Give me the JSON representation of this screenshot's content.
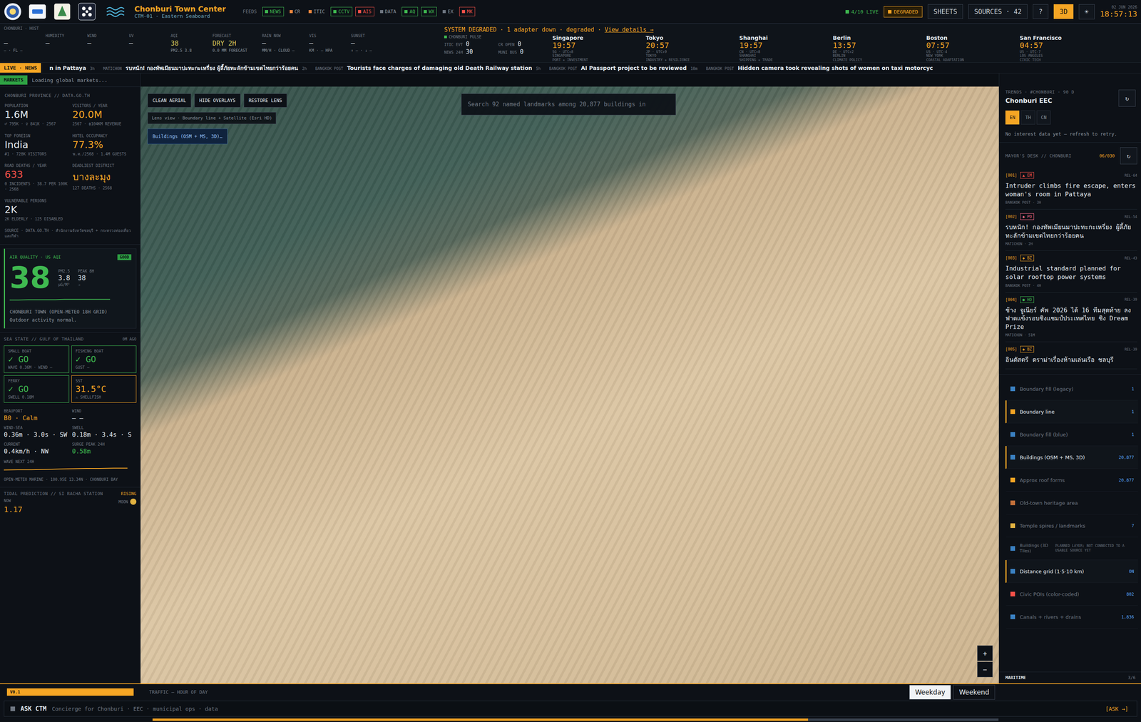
{
  "topbar": {
    "title": "Chonburi Town Center",
    "subtitle": "CTM-01 · Eastern Seaboard",
    "feeds_label": "FEEDS",
    "feeds": [
      {
        "label": "NEWS",
        "color": "#3fb950",
        "boxed": true
      },
      {
        "label": "CR",
        "color": "#f0883e",
        "boxed": false
      },
      {
        "label": "ITIC",
        "color": "#f0883e",
        "boxed": false
      },
      {
        "label": "CCTV",
        "color": "#3fb950",
        "boxed": true
      },
      {
        "label": "AIS",
        "color": "#f85149",
        "boxed": true
      },
      {
        "label": "DATA",
        "color": "#6e7681",
        "boxed": false
      },
      {
        "label": "AQ",
        "color": "#3fb950",
        "boxed": true
      },
      {
        "label": "WX",
        "color": "#3fb950",
        "boxed": true
      },
      {
        "label": "EX",
        "color": "#6e7681",
        "boxed": false
      },
      {
        "label": "MK",
        "color": "#f85149",
        "boxed": true
      }
    ],
    "live": "4/10 LIVE",
    "status": "DEGRADED",
    "buttons": [
      "SHEETS",
      "SOURCES · 42",
      "?"
    ],
    "mode": {
      "label": "3D",
      "selected": true
    },
    "theme_icon": "☀",
    "date": "02 JUN 2026",
    "time": "18:57:13"
  },
  "weather": {
    "host": "CHONBURI · HOST",
    "items": [
      {
        "label": "",
        "value": "—",
        "sub": "— · FL —",
        "color": "#e6edf3"
      },
      {
        "label": "HUMIDITY",
        "value": "—",
        "sub": "",
        "color": "#e6edf3"
      },
      {
        "label": "WIND",
        "value": "—",
        "sub": "",
        "color": "#e6edf3"
      },
      {
        "label": "UV",
        "value": "—",
        "sub": "",
        "color": "#e6edf3"
      },
      {
        "label": "AQI",
        "value": "38",
        "sub": "PM2.5 3.8",
        "color": "#d6c85a"
      },
      {
        "label": "FORECAST",
        "value": "DRY 2H",
        "sub": "0.0 MM FORECAST",
        "color": "#d6c85a"
      },
      {
        "label": "RAIN NOW",
        "value": "—",
        "sub": "MM/H · CLOUD —",
        "color": "#e6edf3"
      },
      {
        "label": "VIS",
        "value": "—",
        "sub": "KM · — HPA",
        "color": "#e6edf3"
      },
      {
        "label": "SUNSET",
        "value": "—",
        "sub": "↑ — · ↓ —",
        "color": "#e6edf3"
      }
    ]
  },
  "banner": {
    "text": "SYSTEM DEGRADED · 1 adapter down · degraded · ",
    "link": "View details →"
  },
  "pulse": {
    "label": "CHONBURI PULSE",
    "stats": [
      {
        "label": "ITIC EVT",
        "value": "0"
      },
      {
        "label": "CR OPEN",
        "value": "0"
      },
      {
        "label": "NEWS 24H",
        "value": "30"
      },
      {
        "label": "MUNI BUS",
        "value": "0"
      }
    ]
  },
  "clocks": [
    {
      "city": "Singapore",
      "time": "19:57",
      "zone": "SG · UTC+8",
      "name": "SINGAPORE",
      "theme": "PORT + INVESTMENT"
    },
    {
      "city": "Tokyo",
      "time": "20:57",
      "zone": "JP · UTC+9",
      "name": "TOKYO",
      "theme": "INDUSTRY + RESILIENCE"
    },
    {
      "city": "Shanghai",
      "time": "19:57",
      "zone": "CN · UTC+8",
      "name": "SHANGHAI",
      "theme": "SHIPPING + TRADE"
    },
    {
      "city": "Berlin",
      "time": "13:57",
      "zone": "DE · UTC+2",
      "name": "BERLIN",
      "theme": "CLIMATE POLICY"
    },
    {
      "city": "Boston",
      "time": "07:57",
      "zone": "US · UTC-4",
      "name": "NEW YORK",
      "theme": "COASTAL ADAPTATION"
    },
    {
      "city": "San Francisco",
      "time": "04:57",
      "zone": "US · UTC-7",
      "name": "LOS ANGELES",
      "theme": "CIVIC TECH"
    }
  ],
  "ticker": {
    "badge": "LIVE · NEWS",
    "items": [
      {
        "source": "",
        "text": "n in Pattaya",
        "age": "3h"
      },
      {
        "source": "MATICHON",
        "text": "รบหนัก! กองทัพเมียนมาปะทะกะเหรี่ยง ผู้ลี้ภัยทะลักข้ามเขตไทยกว่าร้อยคน",
        "age": "2h"
      },
      {
        "source": "BANGKOK POST",
        "text": "Tourists face charges of damaging old Death Railway station",
        "age": "5h"
      },
      {
        "source": "BANGKOK POST",
        "text": "AI Passport project to be reviewed",
        "age": "10m"
      },
      {
        "source": "BANGKOK POST",
        "text": "Hidden camera took revealing shots of women on taxi motorcyc",
        "age": ""
      }
    ]
  },
  "markets": {
    "badge": "MARKETS",
    "text": "Loading global markets..."
  },
  "province": {
    "title": "CHONBURI PROVINCE // DATA.GO.TH",
    "stats": [
      {
        "label": "POPULATION",
        "value": "1.6M",
        "sub": "♂ 795K · ♀ 841K · 2567",
        "color": "#e6edf3"
      },
      {
        "label": "VISITORS / YEAR",
        "value": "20.0M",
        "sub": "2567 · ฿104KM REVENUE",
        "color": "#f5a524"
      },
      {
        "label": "TOP FOREIGN",
        "value": "India",
        "sub": "#1 · 728K VISITORS",
        "color": "#e6edf3"
      },
      {
        "label": "HOTEL OCCUPANCY",
        "value": "77.3%",
        "sub": "พ.ศ./2568 · 1.4M GUESTS",
        "color": "#f5a524"
      },
      {
        "label": "ROAD DEATHS / YEAR",
        "value": "633",
        "sub": "0 INCIDENTS · 38.7 PER 100K · 2568",
        "color": "#f85149"
      },
      {
        "label": "DEADLIEST DISTRICT",
        "value": "บางละมุง",
        "sub": "127 DEATHS · 2568",
        "color": "#f5a524"
      },
      {
        "label": "VULNERABLE PERSONS",
        "value": "2K",
        "sub": "2K ELDERLY · 125 DISABLED",
        "color": "#e6edf3"
      }
    ],
    "source": "SOURCE · DATA.GO.TH · สำนักงานจังหวัดชลบุรี + กระทรวงท่องเที่ยวและกีฬา"
  },
  "air": {
    "title": "AIR QUALITY · US AQI",
    "badge": "GOOD",
    "value": "38",
    "pm_label": "PM2.5",
    "pm_value": "3.8",
    "pm_unit": "µG/M³",
    "peak_label": "PEAK 8H",
    "peak_value": "38",
    "peak_trend": "→",
    "series": [
      36,
      36,
      37,
      37,
      37,
      37,
      38,
      38,
      38,
      38,
      38,
      38
    ],
    "place": "CHONBURI TOWN (OPEN-METEO 18H GRID)",
    "advice": "Outdoor activity normal."
  },
  "sea": {
    "title": "SEA STATE // GULF OF THAILAND",
    "age": "0M AGO",
    "cards": [
      {
        "label": "SMALL BOAT",
        "value": "✓ GO",
        "sub": "WAVE 0.36M · WIND —",
        "color": "#3fb950"
      },
      {
        "label": "FISHING BOAT",
        "value": "✓ GO",
        "sub": "GUST —",
        "color": "#3fb950"
      },
      {
        "label": "FERRY",
        "value": "✓ GO",
        "sub": "SWELL 0.18M",
        "color": "#3fb950"
      },
      {
        "label": "SST",
        "value": "31.5°C",
        "sub": "⚠ SHELLFISH",
        "color": "#f5a524"
      }
    ],
    "conditions": [
      {
        "label": "BEAUFORT",
        "value": "B0 · Calm",
        "color": "#f5a524"
      },
      {
        "label": "WIND",
        "value": "— —",
        "color": "#e6edf3"
      },
      {
        "label": "WIND-SEA",
        "value": "0.36m · 3.0s · SW",
        "color": "#e6edf3"
      },
      {
        "label": "SWELL",
        "value": "0.18m · 3.4s · S",
        "color": "#e6edf3"
      },
      {
        "label": "CURRENT",
        "value": "0.4km/h · NW",
        "color": "#e6edf3"
      },
      {
        "label": "SURGE PEAK 24H",
        "value": "0.58m",
        "color": "#3fb950"
      }
    ],
    "wave_label": "WAVE NEXT 24H",
    "wave_series": [
      0.3,
      0.31,
      0.31,
      0.32,
      0.33,
      0.34,
      0.35,
      0.35,
      0.36,
      0.36
    ],
    "source": "OPEN-METEO MARINE · 100.95E 13.34N · CHONBURI BAY"
  },
  "tide": {
    "title": "TIDAL PREDICTION // SI RACHA STATION",
    "status": "RISING",
    "now_label": "NOW",
    "moon_label": "MOON",
    "now_value": "1.17"
  },
  "map": {
    "controls": [
      {
        "label": "CLEAN AERIAL",
        "selected": false
      },
      {
        "label": "HIDE OVERLAYS",
        "selected": false
      },
      {
        "label": "RESTORE LENS",
        "selected": false
      }
    ],
    "lens": "Lens view · Boundary line + Satellite (Esri HD)",
    "layer_chip": "Buildings (OSM + MS, 3D)…",
    "search_placeholder": "Search 92 named landmarks among 20,877 buildings in",
    "zoom": [
      "+",
      "−"
    ]
  },
  "trends": {
    "header": "TRENDS · #CHONBURI · 90 D",
    "title": "Chonburi EEC",
    "refresh": "↻",
    "langs": [
      {
        "label": "EN",
        "selected": true
      },
      {
        "label": "TH",
        "selected": false
      },
      {
        "label": "CN",
        "selected": false
      }
    ],
    "empty": "No interest data yet — refresh to retry."
  },
  "mayor": {
    "header": "MAYOR'S DESK // CHONBURI",
    "count": "06/030",
    "refresh": "↻",
    "items": [
      {
        "num": "[001]",
        "tag": "▲ EM",
        "color": "#f85149",
        "title": "Intruder climbs fire escape, enters woman's room in Pattaya",
        "source": "BANGKOK POST · 3H",
        "rel": "REL-64"
      },
      {
        "num": "[002]",
        "tag": "◆ PO",
        "color": "#ff6b8b",
        "title": "รบหนัก! กองทัพเมียนมาปะทะกะเหรี่ยง ผู้ลี้ภัยทะลักข้ามเขตไทยกว่าร้อยคน",
        "source": "MATICHON · 2H",
        "rel": "REL-54"
      },
      {
        "num": "[003]",
        "tag": "◆ BZ",
        "color": "#f5a524",
        "title": "Industrial standard planned for solar rooftop power systems",
        "source": "BANGKOK POST · 4H",
        "rel": "REL-43"
      },
      {
        "num": "[004]",
        "tag": "● HO",
        "color": "#3fb950",
        "title": "ช้าง จูเนียร์ คัพ 2026 ได้ 16 ทีมสุดท้าย ลงฟาดแข้งรอบชิงแชมป์ประเทศไทย ชิง Dream Prize",
        "source": "MATICHON · 51M",
        "rel": "REL-39"
      },
      {
        "num": "[005]",
        "tag": "◆ BZ",
        "color": "#f5a524",
        "title": "อินดัสตรี ดราม่าเรื่องห้ามเล่นเรือ ชลบุรี",
        "source": "",
        "rel": "REL-39"
      }
    ]
  },
  "layers": [
    {
      "label": "Boundary fill (legacy)",
      "count": "1",
      "on": false,
      "color": "#3b82c4",
      "kind": "toggle",
      "note": ""
    },
    {
      "label": "Boundary line",
      "count": "1",
      "on": true,
      "color": "#f5a524",
      "kind": "toggle",
      "note": ""
    },
    {
      "label": "Boundary fill (blue)",
      "count": "1",
      "on": false,
      "color": "#3b82c4",
      "kind": "toggle",
      "note": ""
    },
    {
      "label": "Buildings (OSM + MS, 3D)",
      "count": "20,877",
      "on": true,
      "color": "#3b82c4",
      "kind": "toggle",
      "note": ""
    },
    {
      "label": "Approx roof forms",
      "count": "20,877",
      "on": false,
      "color": "#f5a524",
      "kind": "toggle",
      "note": ""
    },
    {
      "label": "Old-town heritage area",
      "count": "",
      "on": false,
      "color": "#c2703a",
      "kind": "toggle",
      "note": ""
    },
    {
      "label": "Temple spires / landmarks",
      "count": "7",
      "on": false,
      "color": "#e3b341",
      "kind": "toggle",
      "note": ""
    },
    {
      "label": "Buildings (3D Tiles)",
      "count": "",
      "on": false,
      "color": "#3b82c4",
      "kind": "planned",
      "note": "PLANNED LAYER; NOT CONNECTED TO A USABLE SOURCE YET"
    },
    {
      "label": "Distance grid (1·5·10 km)",
      "count": "ON",
      "on": true,
      "color": "#3b82c4",
      "kind": "toggle",
      "note": ""
    },
    {
      "label": "Civic POIs (color-coded)",
      "count": "802",
      "on": false,
      "color": "#f85149",
      "kind": "toggle",
      "note": ""
    },
    {
      "label": "Canals + rivers + drains",
      "count": "1,836",
      "on": false,
      "color": "#3b82c4",
      "kind": "toggle",
      "note": ""
    }
  ],
  "maritime": {
    "label": "MARITIME",
    "count": "3/6"
  },
  "bottom": {
    "version": "V0.1",
    "traffic_label": "TRAFFIC — HOUR OF DAY",
    "tabs": [
      {
        "label": "Weekday",
        "selected": true
      },
      {
        "label": "Weekend",
        "selected": false
      }
    ],
    "ask_label": "ASK CTM",
    "ask_placeholder": "Concierge for Chonburi · EEC · municipal ops · data",
    "ask_button": "[ASK →]",
    "progress": 0.775
  }
}
